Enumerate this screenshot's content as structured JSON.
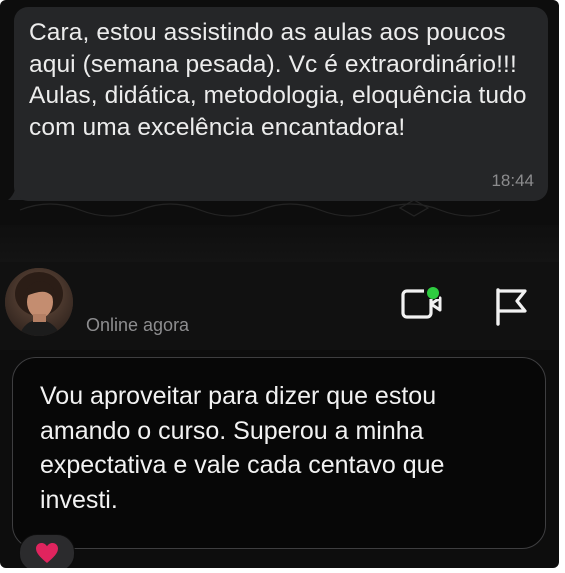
{
  "received_message": {
    "text": "Cara, estou assistindo as aulas aos poucos aqui (semana pesada). Vc é extraordinário!!! Aulas, didática, metodologia, eloquência tudo com uma excelência encantadora!",
    "time": "18:44"
  },
  "chat_header": {
    "status": "Online agora",
    "icons": [
      "avatar",
      "video-call-icon",
      "flag-icon"
    ],
    "online_dot_color": "#2ecc40"
  },
  "sent_message": {
    "text": "Vou aproveitar para dizer que estou amando o curso. Superou a minha expectativa e vale cada centavo que investi.",
    "reaction": "heart-icon"
  },
  "colors": {
    "background": "#0d0d0d",
    "bubble": "#252628",
    "card_border": "#3e3e40",
    "heart": "#e0245e"
  }
}
